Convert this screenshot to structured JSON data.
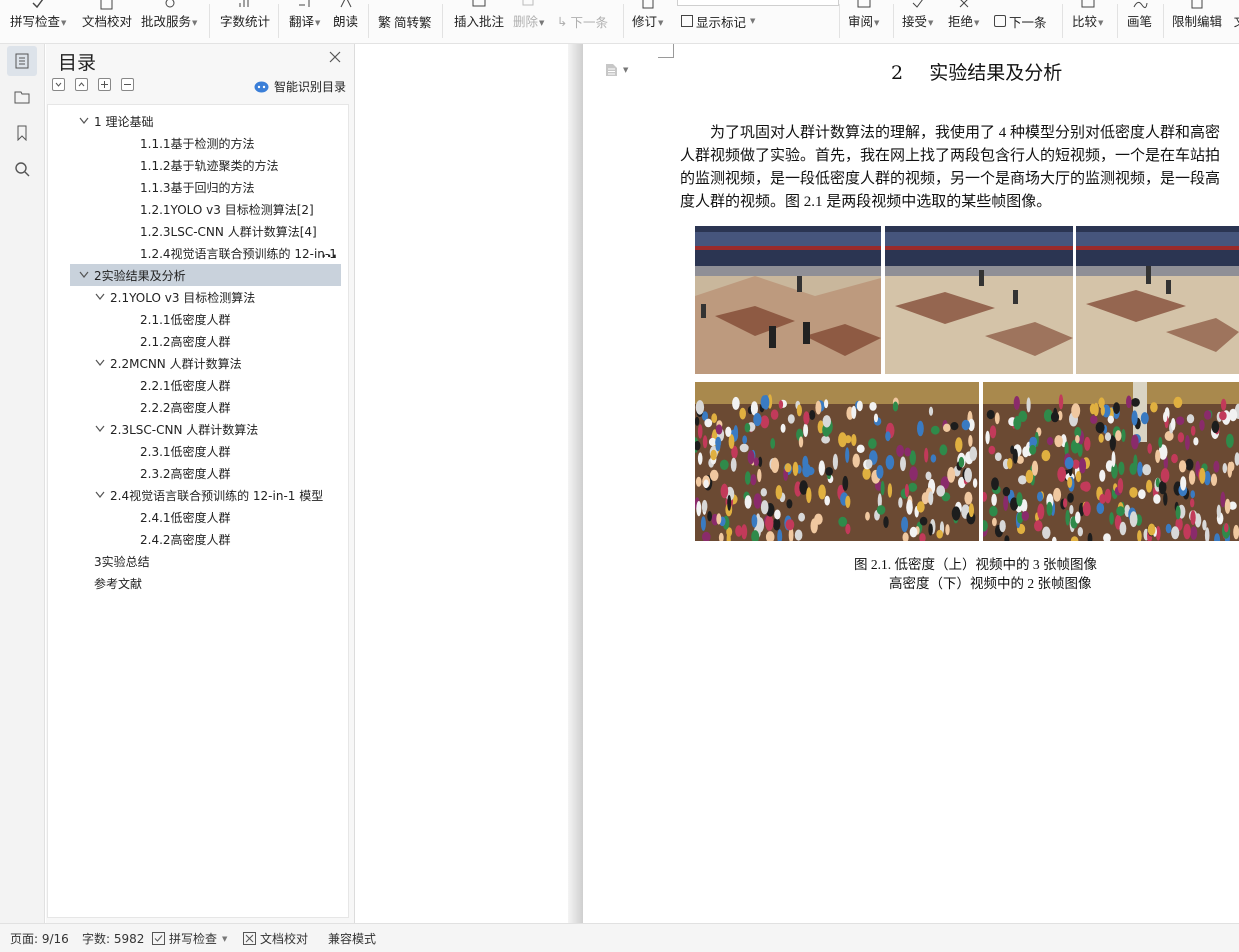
{
  "ribbon": {
    "spell_check": "拼写检查",
    "doc_proofread": "文档校对",
    "batch_service": "批改服务",
    "word_count": "字数统计",
    "translate": "翻译",
    "read_aloud": "朗读",
    "simp_trad": "简转繁",
    "insert_comment": "插入批注",
    "delete": "删除",
    "next_comment": "下一条",
    "track_changes": "修订",
    "show_markup": "显示标记",
    "review": "审阅",
    "accept": "接受",
    "reject": "拒绝",
    "next_change": "下一条",
    "compare": "比较",
    "ink": "画笔",
    "restrict_edit": "限制编辑",
    "cut_off": "文"
  },
  "outline": {
    "title": "目录",
    "smart_toc": "智能识别目录",
    "items": [
      {
        "label": "1 理论基础",
        "level": 1,
        "expanded": true
      },
      {
        "label": "1.1.1基于检测的方法",
        "level": 3
      },
      {
        "label": "1.1.2基于轨迹聚类的方法",
        "level": 3
      },
      {
        "label": "1.1.3基于回归的方法",
        "level": 3
      },
      {
        "label": "1.2.1YOLO v3 目标检测算法[2]",
        "level": 3
      },
      {
        "label": "1.2.3LSC-CNN 人群计数算法[4]",
        "level": 3
      },
      {
        "label": "1.2.4视觉语言联合预训练的 12-in-1",
        "level": 3,
        "truncated": true
      },
      {
        "label": "2实验结果及分析",
        "level": 1,
        "expanded": true,
        "selected": true
      },
      {
        "label": "2.1YOLO v3 目标检测算法",
        "level": 2,
        "expanded": true
      },
      {
        "label": "2.1.1低密度人群",
        "level": 3
      },
      {
        "label": "2.1.2高密度人群",
        "level": 3
      },
      {
        "label": "2.2MCNN 人群计数算法",
        "level": 2,
        "expanded": true
      },
      {
        "label": "2.2.1低密度人群",
        "level": 3
      },
      {
        "label": "2.2.2高密度人群",
        "level": 3
      },
      {
        "label": "2.3LSC-CNN 人群计数算法",
        "level": 2,
        "expanded": true
      },
      {
        "label": "2.3.1低密度人群",
        "level": 3
      },
      {
        "label": "2.3.2高密度人群",
        "level": 3
      },
      {
        "label": "2.4视觉语言联合预训练的 12-in-1 模型",
        "level": 2,
        "expanded": true
      },
      {
        "label": "2.4.1低密度人群",
        "level": 3
      },
      {
        "label": "2.4.2高密度人群",
        "level": 3
      },
      {
        "label": "3实验总结",
        "level": 1
      },
      {
        "label": "参考文献",
        "level": 1
      }
    ],
    "more_glyph": "..."
  },
  "document": {
    "heading_num": "2",
    "heading_text": "实验结果及分析",
    "para_lines": [
      "为了巩固对人群计数算法的理解，我使用了  4 种模型分别对低密度人群和高密",
      "人群视频做了实验。首先，我在网上找了两段包含行人的短视频，一个是在车站拍",
      "的监测视频，是一段低密度人群的视频，另一个是商场大厅的监测视频，是一段高",
      "度人群的视频。图  2.1 是两段视频中选取的某些帧图像。"
    ],
    "caption_line1": "图 2.1. 低密度（上）视频中的 3 张帧图像",
    "caption_line2": "高密度（下）视频中的 2 张帧图像"
  },
  "status": {
    "page": "页面: 9/16",
    "word_count": "字数: 5982",
    "spell_check": "拼写检查",
    "doc_proofread": "文档校对",
    "compat_mode": "兼容模式"
  },
  "colors": {
    "accent": "#3b7fd8",
    "selected_row": "#c9d2dc",
    "rail_active": "#dde3ea"
  }
}
